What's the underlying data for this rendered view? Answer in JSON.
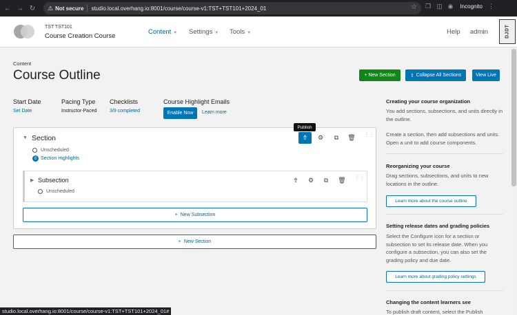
{
  "browser": {
    "not_secure": "Not secure",
    "url": "studio.local.overhang.io:8001/course/course-v1:TST+TST101+2024_01",
    "incognito": "Incognito",
    "status_url": "studio.local.overhang.io:8001/course/course-v1:TST+TST101+2024_01#"
  },
  "header": {
    "course_org": "TST TST101",
    "course_name": "Course Creation Course",
    "nav": [
      "Content",
      "Settings",
      "Tools"
    ],
    "help": "Help",
    "user": "admin",
    "djdt": "DJDT"
  },
  "page": {
    "breadcrumb": "Content",
    "title": "Course Outline",
    "new_section": "+ New Section",
    "collapse_all": "Collapse All Sections",
    "view_live": "View Live"
  },
  "stats": {
    "start_date_label": "Start Date",
    "start_date_value": "Set Date",
    "pacing_label": "Pacing Type",
    "pacing_value": "Instructor-Paced",
    "checklists_label": "Checklists",
    "checklists_value": "3/9 completed",
    "emails_label": "Course Highlight Emails",
    "enable_now": "Enable Now",
    "learn_more": "Learn more"
  },
  "outline": {
    "tooltip": "Publish",
    "section_title": "Section",
    "section_status": "Unscheduled",
    "highlights_count": "0",
    "highlights_label": "Section Highlights",
    "subsection_title": "Subsection",
    "subsection_status": "Unscheduled",
    "new_subsection": "New Subsection",
    "new_section": "New Section"
  },
  "sidebar": {
    "h1": "Creating your course organization",
    "p1a": "You add sections, subsections, and units directly in the outline.",
    "p1b": "Create a section, then add subsections and units. Open a unit to add course components.",
    "h2": "Reorganizing your course",
    "p2": "Drag sections, subsections, and units to new locations in the outline.",
    "btn2": "Learn more about the course outline",
    "h3": "Setting release dates and grading policies",
    "p3": "Select the Configure icon for a section or subsection to set its release date. When you configure a subsection, you can also set the grading policy and due date.",
    "btn3": "Learn more about grading policy settings",
    "h4": "Changing the content learners see",
    "p4": "To publish draft content, select the Publish"
  },
  "colors": {
    "brand_blue": "#0075b4",
    "green": "#0f8617"
  }
}
